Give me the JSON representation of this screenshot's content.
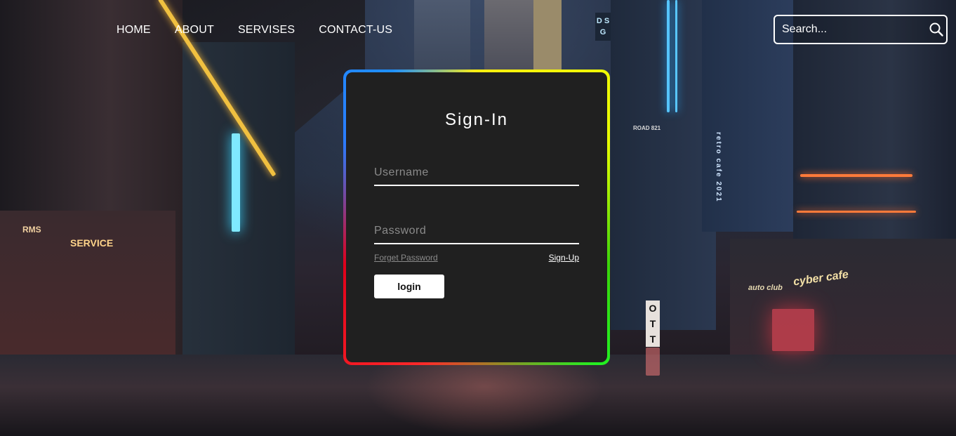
{
  "nav": {
    "items": [
      "HOME",
      "ABOUT",
      "SERVISES",
      "CONTACT-US"
    ]
  },
  "search": {
    "placeholder": "Search...",
    "icon": "search-icon"
  },
  "login_card": {
    "title": "Sign-In",
    "username_placeholder": "Username",
    "password_placeholder": "Password",
    "forgot_label": "Forget Password",
    "signup_label": "Sign-Up",
    "login_label": "login",
    "border_colors": [
      "#1e90ff",
      "#ffee10",
      "#22f022",
      "#ff2a2a"
    ]
  },
  "background_signs": {
    "dsg": "D S G",
    "road": "ROAD 821",
    "vertical": "retro cafe 2021",
    "ott": "O T T",
    "cyber_cafe": "cyber cafe",
    "club": "auto club",
    "service": "SERVICE",
    "rms": "RMS"
  }
}
